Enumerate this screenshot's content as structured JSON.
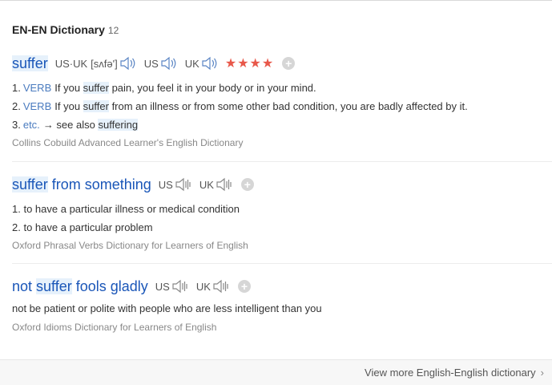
{
  "header": {
    "title": "EN-EN Dictionary",
    "count": "12"
  },
  "entries": [
    {
      "headword_hl": "suffer",
      "headword_rest": "",
      "prons": [
        {
          "label": "US·UK",
          "phonetic": "[sʌfə']"
        },
        {
          "label": "US"
        },
        {
          "label": "UK"
        }
      ],
      "stars": "★★★★",
      "defs": [
        {
          "num": "1.",
          "pos": "VERB",
          "pre": "If you ",
          "hl": "suffer",
          "post": " pain, you feel it in your body or in your mind."
        },
        {
          "num": "2.",
          "pos": "VERB",
          "pre": "If you ",
          "hl": "suffer",
          "post": " from an illness or from some other bad condition, you are badly affected by it."
        },
        {
          "num": "3.",
          "pos": "etc.",
          "pre": "→ see also ",
          "hl": "suffering",
          "post": ""
        }
      ],
      "source": "Collins Cobuild Advanced Learner's English Dictionary"
    },
    {
      "headword_hl": "suffer",
      "headword_rest": " from something",
      "prons": [
        {
          "label": "US"
        },
        {
          "label": "UK"
        }
      ],
      "defs": [
        {
          "num": "1.",
          "text": "to have a particular illness or medical condition"
        },
        {
          "num": "2.",
          "text": "to have a particular problem"
        }
      ],
      "source": "Oxford Phrasal Verbs Dictionary for Learners of English"
    },
    {
      "headword_pre": "not ",
      "headword_hl": "suffer",
      "headword_rest": " fools gladly",
      "prons": [
        {
          "label": "US"
        },
        {
          "label": "UK"
        }
      ],
      "definition": "not be patient or polite with people who are less intelligent than you",
      "source": "Oxford Idioms Dictionary for Learners of English"
    }
  ],
  "footer": {
    "more_label": "View more English-English dictionary",
    "chevron": "›"
  },
  "icons": {
    "speaker": "speaker-icon",
    "add": "plus-icon",
    "chevron": "chevron-right-icon"
  },
  "colors": {
    "link": "#1a56b8",
    "highlight": "#e6f1fb",
    "stars": "#e8584a",
    "pos": "#4a7bbf"
  }
}
